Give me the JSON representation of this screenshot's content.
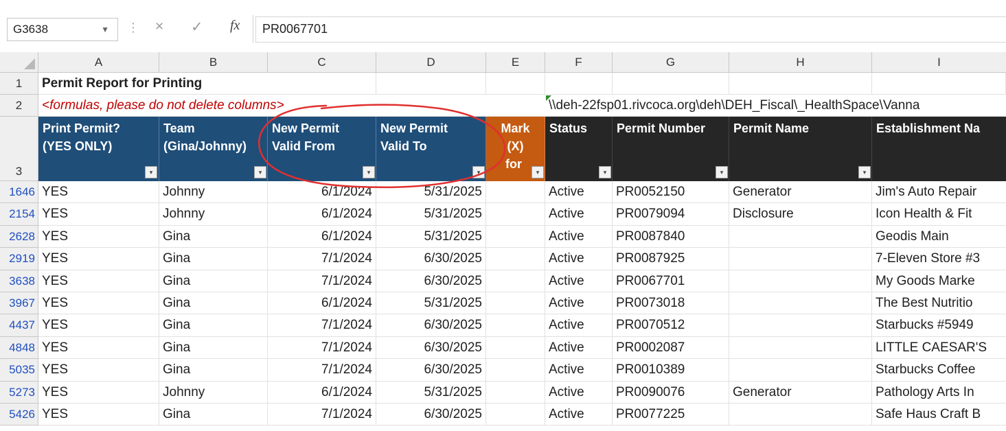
{
  "formula_bar": {
    "name_box": "G3638",
    "cancel_icon": "×",
    "enter_icon": "✓",
    "fx_label": "fx",
    "formula": "PR0067701"
  },
  "columns": [
    "A",
    "B",
    "C",
    "D",
    "E",
    "F",
    "G",
    "H",
    "I"
  ],
  "row1": {
    "num": "1",
    "title": "Permit Report for Printing"
  },
  "row2": {
    "num": "2",
    "note": "<formulas, please do not delete columns>",
    "path": "\\\\deh-22fsp01.rivcoca.org\\deh\\DEH_Fiscal\\_HealthSpace\\Vanna"
  },
  "header_row": {
    "num": "3",
    "a": [
      "Print Permit?",
      "(YES ONLY)"
    ],
    "b": [
      "Team",
      "(Gina/Johnny)"
    ],
    "c": [
      "New Permit",
      "Valid From"
    ],
    "d": [
      "New Permit",
      "Valid To"
    ],
    "e": [
      "Mark",
      "(X)",
      "for"
    ],
    "f": "Status",
    "g": "Permit Number",
    "h": "Permit Name",
    "i": "Establishment Na"
  },
  "rows": [
    {
      "num": "1646",
      "print": "YES",
      "team": "Johnny",
      "from": "6/1/2024",
      "to": "5/31/2025",
      "mark": "",
      "status": "Active",
      "permit": "PR0052150",
      "name": "Generator",
      "est": "Jim's Auto Repair"
    },
    {
      "num": "2154",
      "print": "YES",
      "team": "Johnny",
      "from": "6/1/2024",
      "to": "5/31/2025",
      "mark": "",
      "status": "Active",
      "permit": "PR0079094",
      "name": "Disclosure",
      "est": "Icon Health & Fit"
    },
    {
      "num": "2628",
      "print": "YES",
      "team": "Gina",
      "from": "6/1/2024",
      "to": "5/31/2025",
      "mark": "",
      "status": "Active",
      "permit": "PR0087840",
      "name": "",
      "est": "Geodis Main"
    },
    {
      "num": "2919",
      "print": "YES",
      "team": "Gina",
      "from": "7/1/2024",
      "to": "6/30/2025",
      "mark": "",
      "status": "Active",
      "permit": "PR0087925",
      "name": "",
      "est": "7-Eleven Store #3"
    },
    {
      "num": "3638",
      "print": "YES",
      "team": "Gina",
      "from": "7/1/2024",
      "to": "6/30/2025",
      "mark": "",
      "status": "Active",
      "permit": "PR0067701",
      "name": "",
      "est": "My Goods Marke"
    },
    {
      "num": "3967",
      "print": "YES",
      "team": "Gina",
      "from": "6/1/2024",
      "to": "5/31/2025",
      "mark": "",
      "status": "Active",
      "permit": "PR0073018",
      "name": "",
      "est": "The Best Nutritio"
    },
    {
      "num": "4437",
      "print": "YES",
      "team": "Gina",
      "from": "7/1/2024",
      "to": "6/30/2025",
      "mark": "",
      "status": "Active",
      "permit": "PR0070512",
      "name": "",
      "est": "Starbucks #5949"
    },
    {
      "num": "4848",
      "print": "YES",
      "team": "Gina",
      "from": "7/1/2024",
      "to": "6/30/2025",
      "mark": "",
      "status": "Active",
      "permit": "PR0002087",
      "name": "",
      "est": "LITTLE CAESAR'S"
    },
    {
      "num": "5035",
      "print": "YES",
      "team": "Gina",
      "from": "7/1/2024",
      "to": "6/30/2025",
      "mark": "",
      "status": "Active",
      "permit": "PR0010389",
      "name": "",
      "est": "Starbucks Coffee"
    },
    {
      "num": "5273",
      "print": "YES",
      "team": "Johnny",
      "from": "6/1/2024",
      "to": "5/31/2025",
      "mark": "",
      "status": "Active",
      "permit": "PR0090076",
      "name": "Generator",
      "est": "Pathology Arts In"
    },
    {
      "num": "5426",
      "print": "YES",
      "team": "Gina",
      "from": "7/1/2024",
      "to": "6/30/2025",
      "mark": "",
      "status": "Active",
      "permit": "PR0077225",
      "name": "",
      "est": "Safe Haus Craft B"
    }
  ],
  "colors": {
    "header_blue": "#1f4e79",
    "header_orange": "#c55a11",
    "header_dark": "#262626",
    "annotation_red": "#e03030"
  }
}
